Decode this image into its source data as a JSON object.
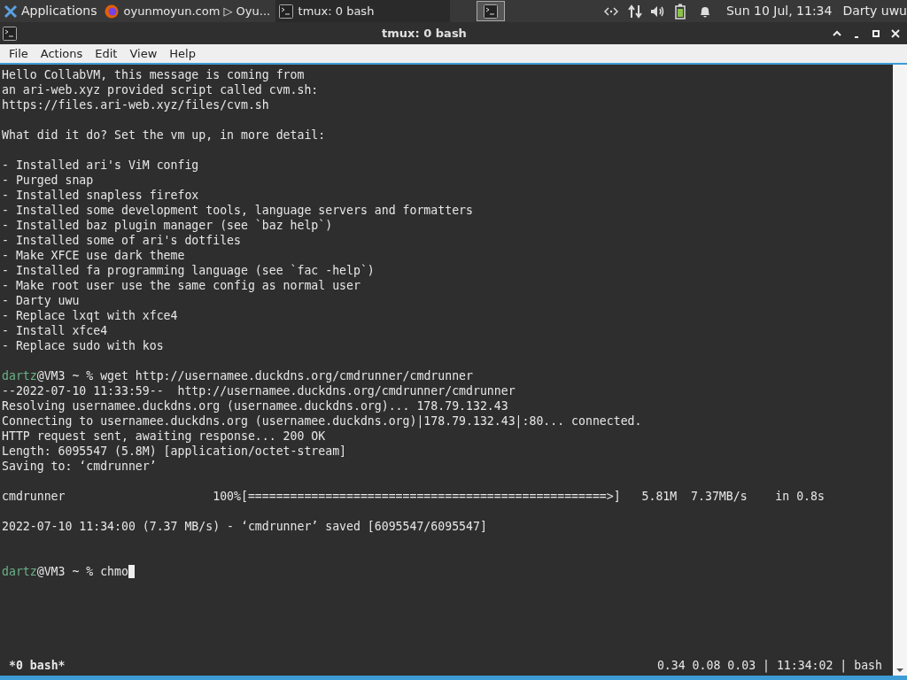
{
  "taskbar": {
    "menu_label": "Applications",
    "tasks": [
      {
        "label": "oyunmoyun.com ▷ Oyu...",
        "kind": "browser",
        "selected": false
      },
      {
        "label": "tmux: 0 bash",
        "kind": "terminal",
        "selected": true
      }
    ],
    "clock": "Sun 10 Jul, 11:34",
    "user": "Darty uwu"
  },
  "window": {
    "title": "tmux: 0 bash"
  },
  "menu": [
    "File",
    "Actions",
    "Edit",
    "View",
    "Help"
  ],
  "terminal": {
    "lines": [
      {
        "kind": "text",
        "text": "Hello CollabVM, this message is coming from"
      },
      {
        "kind": "text",
        "text": "an ari-web.xyz provided script called cvm.sh:"
      },
      {
        "kind": "text",
        "text": "https://files.ari-web.xyz/files/cvm.sh"
      },
      {
        "kind": "blank"
      },
      {
        "kind": "text",
        "text": "What did it do? Set the vm up, in more detail:"
      },
      {
        "kind": "blank"
      },
      {
        "kind": "text",
        "text": "- Installed ari's ViM config"
      },
      {
        "kind": "text",
        "text": "- Purged snap"
      },
      {
        "kind": "text",
        "text": "- Installed snapless firefox"
      },
      {
        "kind": "text",
        "text": "- Installed some development tools, language servers and formatters"
      },
      {
        "kind": "text",
        "text": "- Installed baz plugin manager (see `baz help`)"
      },
      {
        "kind": "text",
        "text": "- Installed some of ari's dotfiles"
      },
      {
        "kind": "text",
        "text": "- Make XFCE use dark theme"
      },
      {
        "kind": "text",
        "text": "- Installed fa programming language (see `fac -help`)"
      },
      {
        "kind": "text",
        "text": "- Make root user use the same config as normal user"
      },
      {
        "kind": "text",
        "text": "- Darty uwu"
      },
      {
        "kind": "text",
        "text": "- Replace lxqt with xfce4"
      },
      {
        "kind": "text",
        "text": "- Install xfce4"
      },
      {
        "kind": "text",
        "text": "- Replace sudo with kos"
      },
      {
        "kind": "blank"
      },
      {
        "kind": "prompt",
        "user": "dartz",
        "rest": "@VM3 ~ % wget http://usernamee.duckdns.org/cmdrunner/cmdrunner",
        "cursor": false
      },
      {
        "kind": "text",
        "text": "--2022-07-10 11:33:59--  http://usernamee.duckdns.org/cmdrunner/cmdrunner"
      },
      {
        "kind": "text",
        "text": "Resolving usernamee.duckdns.org (usernamee.duckdns.org)... 178.79.132.43"
      },
      {
        "kind": "text",
        "text": "Connecting to usernamee.duckdns.org (usernamee.duckdns.org)|178.79.132.43|:80... connected."
      },
      {
        "kind": "text",
        "text": "HTTP request sent, awaiting response... 200 OK"
      },
      {
        "kind": "text",
        "text": "Length: 6095547 (5.8M) [application/octet-stream]"
      },
      {
        "kind": "text",
        "text": "Saving to: ‘cmdrunner’"
      },
      {
        "kind": "blank"
      },
      {
        "kind": "text",
        "text": "cmdrunner                     100%[===================================================>]   5.81M  7.37MB/s    in 0.8s"
      },
      {
        "kind": "blank"
      },
      {
        "kind": "text",
        "text": "2022-07-10 11:34:00 (7.37 MB/s) - ‘cmdrunner’ saved [6095547/6095547]"
      },
      {
        "kind": "blank"
      },
      {
        "kind": "blank"
      },
      {
        "kind": "prompt",
        "user": "dartz",
        "rest": "@VM3 ~ % chmo",
        "cursor": true
      }
    ],
    "status_left": "*0 bash*",
    "status_right": "0.34 0.08 0.03 | 11:34:02 | bash"
  }
}
